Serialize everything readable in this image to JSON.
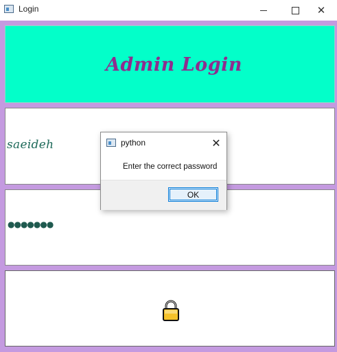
{
  "window": {
    "title": "Login",
    "icon": "python-window-icon"
  },
  "header": {
    "title": "Admin Login",
    "background": "#03ffc9",
    "title_color": "#8e2d8e"
  },
  "form": {
    "username_value": "saeideh",
    "password_value": "●●●●●●●",
    "login_button_icon": "lock-icon",
    "text_color": "#1e6a5a"
  },
  "dialog": {
    "title": "python",
    "message": "Enter the correct password",
    "ok_label": "OK",
    "accent": "#0078d7"
  },
  "colors": {
    "client_background": "#c49ae0"
  }
}
